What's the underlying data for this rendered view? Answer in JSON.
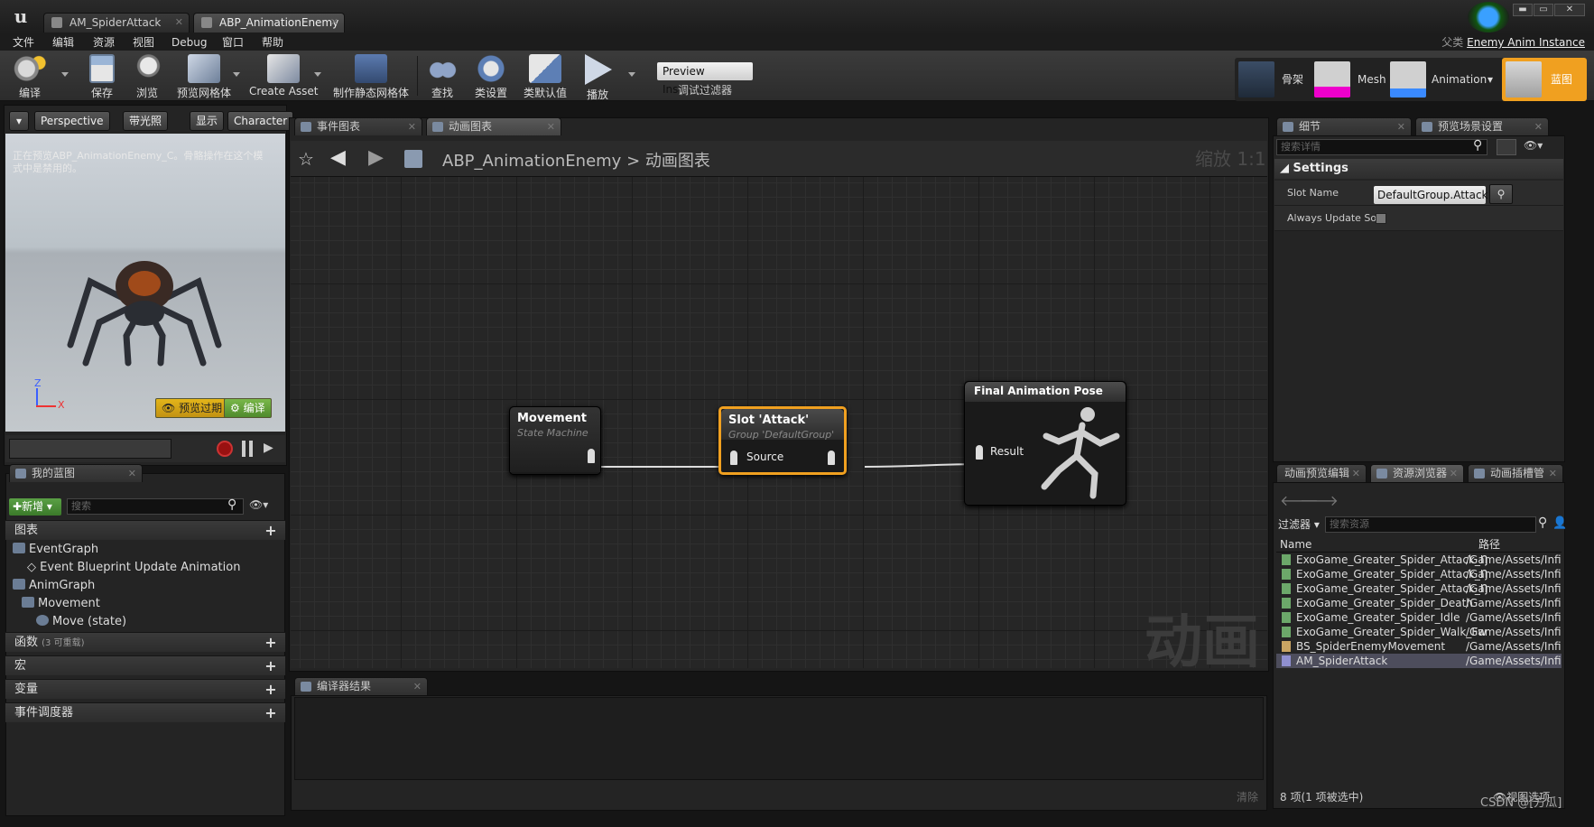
{
  "window": {
    "tabs": [
      {
        "label": "AM_SpiderAttack"
      },
      {
        "label": "ABP_AnimationEnemy"
      }
    ],
    "parent_label": "父类",
    "parent_value": "Enemy Anim Instance"
  },
  "menu": [
    "文件",
    "编辑",
    "资源",
    "视图",
    "Debug",
    "窗口",
    "帮助"
  ],
  "toolbar": {
    "buttons": [
      "编译",
      "保存",
      "浏览",
      "预览网格体",
      "Create Asset",
      "制作静态网格体",
      "查找",
      "类设置",
      "类默认值",
      "播放"
    ],
    "preview_instance": "Preview Instance",
    "debug_filter": "调试过滤器",
    "modes": [
      "骨架",
      "Mesh",
      "Animation",
      "蓝图"
    ]
  },
  "viewport": {
    "buttons": [
      "Perspective",
      "带光照",
      "显示",
      "Character"
    ],
    "note": "正在预览ABP_AnimationEnemy_C。骨骼操作在这个模式中是禁用的。",
    "axis_z": "Z",
    "axis_x": "X",
    "preview_expired": "预览过期",
    "compile": "编译"
  },
  "my_blueprint": {
    "tab": "我的蓝图",
    "new_button": "新增",
    "search_placeholder": "搜索",
    "graphs_section": "图表",
    "tree": [
      "EventGraph",
      "Event Blueprint Update Animation",
      "AnimGraph",
      "Movement",
      "Move (state)"
    ],
    "functions_section": "函数",
    "functions_note": "(3 可重载)",
    "macros_section": "宏",
    "variables_section": "变量",
    "dispatchers_section": "事件调度器"
  },
  "graph": {
    "tabs": [
      "事件图表",
      "动画图表"
    ],
    "breadcrumb_root": "ABP_AnimationEnemy",
    "breadcrumb_sep": ">",
    "breadcrumb_current": "动画图表",
    "zoom": "缩放 1:1",
    "watermark": "动画",
    "nodes": {
      "movement_title": "Movement",
      "movement_sub": "State Machine",
      "slot_title": "Slot 'Attack'",
      "slot_sub": "Group 'DefaultGroup'",
      "slot_pin": "Source",
      "final_title": "Final Animation Pose",
      "final_pin": "Result"
    }
  },
  "compiler": {
    "tab": "编译器结果",
    "clear": "清除"
  },
  "details": {
    "tabs": [
      "细节",
      "预览场景设置"
    ],
    "search_placeholder": "搜索详情",
    "section": "Settings",
    "slot_name_label": "Slot Name",
    "slot_name_value": "DefaultGroup.Attack",
    "always_update_label": "Always Update Soı"
  },
  "content_browser": {
    "tabs": [
      "动画预览编辑",
      "资源浏览器",
      "动画插槽管"
    ],
    "filter": "过滤器",
    "search_placeholder": "搜索资源",
    "col_name": "Name",
    "col_path": "路径",
    "assets": [
      {
        "name": "ExoGame_Greater_Spider_Attack_Ŋ",
        "path": "/Game/Assets/Infiı"
      },
      {
        "name": "ExoGame_Greater_Spider_Attack_Ŋ",
        "path": "/Game/Assets/Infiı"
      },
      {
        "name": "ExoGame_Greater_Spider_Attack_Ŋ",
        "path": "/Game/Assets/Infiı"
      },
      {
        "name": "ExoGame_Greater_Spider_Death",
        "path": "/Game/Assets/Infiı"
      },
      {
        "name": "ExoGame_Greater_Spider_Idle",
        "path": "/Game/Assets/Infiı"
      },
      {
        "name": "ExoGame_Greater_Spider_Walk_Fw",
        "path": "/Game/Assets/Infiı"
      },
      {
        "name": "BS_SpiderEnemyMovement",
        "path": "/Game/Assets/Infiı"
      },
      {
        "name": "AM_SpiderAttack",
        "path": "/Game/Assets/Infiı"
      }
    ],
    "status": "8 项(1 项被选中)",
    "view_options": "视图选项"
  },
  "watermark": "CSDN @[方瓜]"
}
